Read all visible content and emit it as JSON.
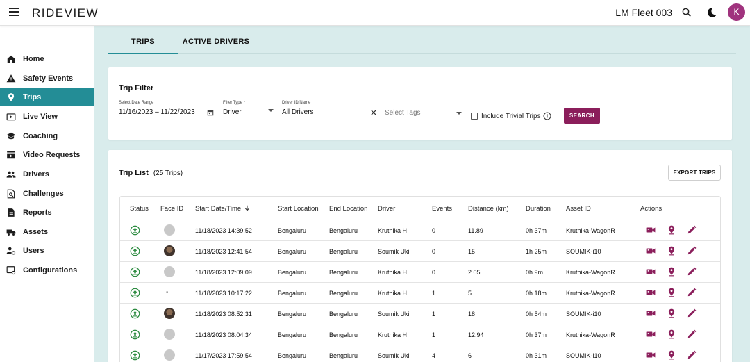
{
  "topbar": {
    "brand": "RIDEVIEW",
    "fleet_name": "LM Fleet 003",
    "avatar_initial": "K",
    "avatar_color": "#a0337e"
  },
  "sidebar": {
    "accent_color": "#238d96",
    "items": [
      {
        "label": "Home",
        "icon": "home-icon"
      },
      {
        "label": "Safety Events",
        "icon": "warning-icon"
      },
      {
        "label": "Trips",
        "icon": "location-pin-icon",
        "active": true
      },
      {
        "label": "Live View",
        "icon": "live-video-icon"
      },
      {
        "label": "Coaching",
        "icon": "graduation-cap-icon"
      },
      {
        "label": "Video Requests",
        "icon": "video-request-icon"
      },
      {
        "label": "Drivers",
        "icon": "people-icon"
      },
      {
        "label": "Challenges",
        "icon": "challenge-search-icon"
      },
      {
        "label": "Reports",
        "icon": "document-icon"
      },
      {
        "label": "Assets",
        "icon": "truck-icon"
      },
      {
        "label": "Users",
        "icon": "user-settings-icon"
      },
      {
        "label": "Configurations",
        "icon": "settings-screen-icon"
      }
    ]
  },
  "tabs": [
    {
      "label": "TRIPS",
      "active": true
    },
    {
      "label": "ACTIVE DRIVERS",
      "active": false
    }
  ],
  "filter": {
    "title": "Trip Filter",
    "date_range": {
      "label": "Select Date Range",
      "value": "11/16/2023 – 11/22/2023"
    },
    "filter_type": {
      "label": "Filter Type *",
      "value": "Driver"
    },
    "driver": {
      "label": "Driver ID/Name",
      "value": "All Drivers"
    },
    "tags": {
      "placeholder": "Select Tags"
    },
    "include_trivial": {
      "label": "Include Trivial Trips",
      "checked": false
    },
    "search_label": "SEARCH",
    "search_color": "#8b1e5b"
  },
  "trip_list": {
    "title": "Trip List",
    "count_text": "(25 Trips)",
    "export_label": "EXPORT TRIPS",
    "columns": [
      "Status",
      "Face ID",
      "Start Date/Time",
      "Start Location",
      "End Location",
      "Driver",
      "Events",
      "Distance (km)",
      "Duration",
      "Asset ID",
      "Actions"
    ],
    "rows": [
      {
        "face": "default",
        "start": "11/18/2023 14:39:52",
        "start_loc": "Bengaluru",
        "end_loc": "Bengaluru",
        "driver": "Kruthika H",
        "events": "0",
        "distance": "11.89",
        "duration": "0h 37m",
        "asset": "Kruthika-WagonR"
      },
      {
        "face": "photo",
        "start": "11/18/2023 12:41:54",
        "start_loc": "Bengaluru",
        "end_loc": "Bengaluru",
        "driver": "Soumik Ukil",
        "events": "0",
        "distance": "15",
        "duration": "1h 25m",
        "asset": "SOUMIK-i10"
      },
      {
        "face": "default",
        "start": "11/18/2023 12:09:09",
        "start_loc": "Bengaluru",
        "end_loc": "Bengaluru",
        "driver": "Kruthika H",
        "events": "0",
        "distance": "2.05",
        "duration": "0h 9m",
        "asset": "Kruthika-WagonR"
      },
      {
        "face": "dash",
        "face_text": "-",
        "start": "11/18/2023 10:17:22",
        "start_loc": "Bengaluru",
        "end_loc": "Bengaluru",
        "driver": "Kruthika H",
        "events": "1",
        "distance": "5",
        "duration": "0h 18m",
        "asset": "Kruthika-WagonR"
      },
      {
        "face": "photo",
        "start": "11/18/2023 08:52:31",
        "start_loc": "Bengaluru",
        "end_loc": "Bengaluru",
        "driver": "Soumik Ukil",
        "events": "1",
        "distance": "18",
        "duration": "0h 54m",
        "asset": "SOUMIK-i10"
      },
      {
        "face": "default",
        "start": "11/18/2023 08:04:34",
        "start_loc": "Bengaluru",
        "end_loc": "Bengaluru",
        "driver": "Kruthika H",
        "events": "1",
        "distance": "12.94",
        "duration": "0h 37m",
        "asset": "Kruthika-WagonR"
      },
      {
        "face": "default",
        "start": "11/17/2023 17:59:54",
        "start_loc": "Bengaluru",
        "end_loc": "Bengaluru",
        "driver": "Soumik Ukil",
        "events": "4",
        "distance": "6",
        "duration": "0h 31m",
        "asset": "SOUMIK-i10"
      }
    ],
    "status_icon": "upload-circle-icon",
    "status_color": "#2a8a3e",
    "action_icons": [
      "video-camera-icon",
      "map-pin-icon",
      "pencil-icon"
    ],
    "action_color": "#8b1e5b"
  }
}
